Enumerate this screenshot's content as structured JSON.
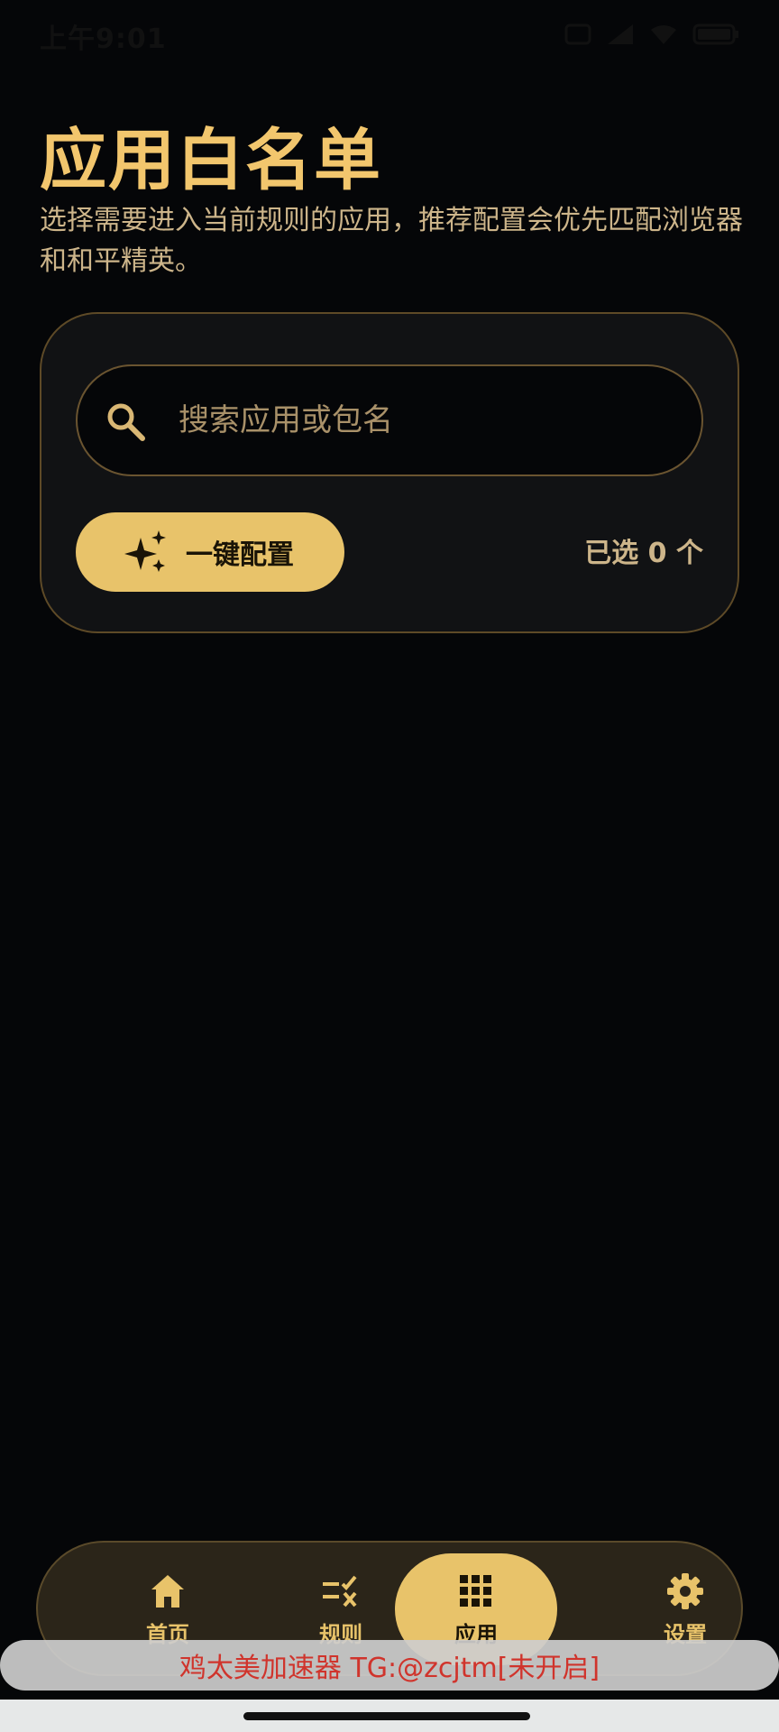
{
  "status_bar": {
    "time": "上午9:01",
    "icons": [
      "sim-icon",
      "signal-icon",
      "wifi-icon",
      "battery-icon"
    ]
  },
  "header": {
    "title": "应用白名单",
    "description": "选择需要进入当前规则的应用，推荐配置会优先匹配浏览器和和平精英。"
  },
  "card": {
    "search": {
      "placeholder": "搜索应用或包名",
      "value": ""
    },
    "config_button_label": "一键配置",
    "selected_text": "已选 0 个"
  },
  "bottom_nav": {
    "items": [
      {
        "label": "首页",
        "icon": "home-icon",
        "active": false
      },
      {
        "label": "规则",
        "icon": "rules-icon",
        "active": false
      },
      {
        "label": "应用",
        "icon": "apps-grid-icon",
        "active": true
      },
      {
        "label": "设置",
        "icon": "gear-icon",
        "active": false
      }
    ]
  },
  "toast": {
    "text": "鸡太美加速器 TG:@zcjtm[未开启]"
  },
  "colors": {
    "background": "#050608",
    "accent": "#e8c36a",
    "title": "#f2c66d",
    "muted_text": "#cdb58a",
    "toast_text": "#d0342c"
  }
}
